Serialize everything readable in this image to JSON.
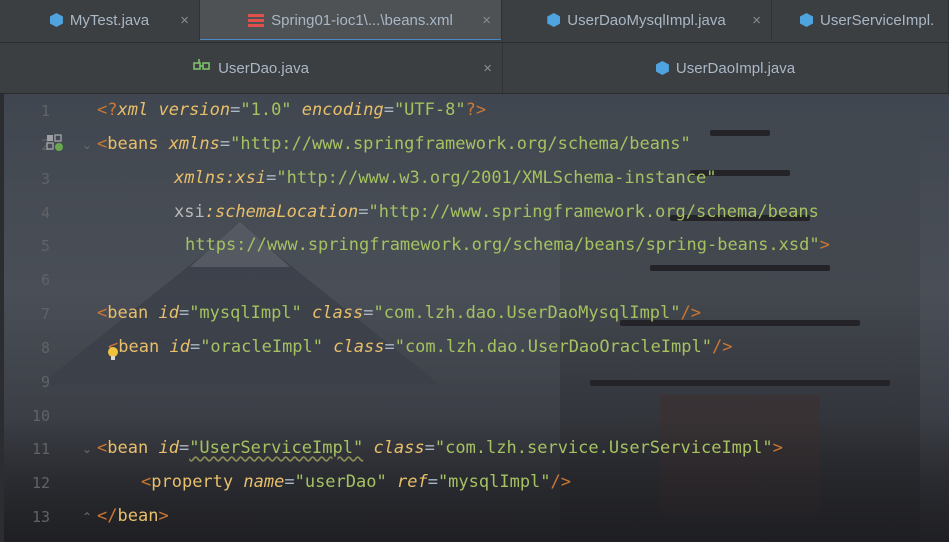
{
  "tabs_top": [
    {
      "label": "MyTest.java",
      "icon": "java-class-icon",
      "active": false
    },
    {
      "label": "Spring01-ioc1\\...\\beans.xml",
      "icon": "xml-file-icon",
      "active": true
    },
    {
      "label": "UserDaoMysqlImpl.java",
      "icon": "java-class-icon",
      "active": false
    },
    {
      "label": "UserServiceImpl.",
      "icon": "java-class-icon",
      "active": false
    }
  ],
  "tabs_second": [
    {
      "label": "UserDao.java",
      "icon": "interface-icon",
      "active": false
    },
    {
      "label": "UserDaoImpl.java",
      "icon": "java-class-icon",
      "active": false
    }
  ],
  "close_glyph": "×",
  "line_numbers": [
    "1",
    "2",
    "3",
    "4",
    "5",
    "6",
    "7",
    "8",
    "9",
    "10",
    "11",
    "12",
    "13"
  ],
  "code": {
    "l1": {
      "open": "<?",
      "pi": "xml",
      "a1": "version",
      "eq1": "=",
      "v1": "\"1.0\"",
      "a2": "encoding",
      "eq2": "=",
      "v2": "\"UTF-8\"",
      "close": "?>"
    },
    "l2": {
      "open": "<",
      "tag": "beans",
      "attr": "xmlns",
      "eq": "=",
      "val": "\"http://www.springframework.org/schema/beans\""
    },
    "l3": {
      "attr": "xmlns:",
      "attr2": "xsi",
      "eq": "=",
      "val": "\"http://www.w3.org/2001/XMLSchema-instance\""
    },
    "l4": {
      "attr": "xsi",
      "attr2": ":schemaLocation",
      "eq": "=",
      "val": "\"http://www.springframework.org/schema/beans"
    },
    "l5": {
      "val": "https://www.springframework.org/schema/beans/spring-beans.xsd\"",
      "close": ">"
    },
    "l7": {
      "open": "<",
      "tag": "bean",
      "a1": "id",
      "eq1": "=",
      "v1": "\"mysqlImpl\"",
      "a2": "class",
      "eq2": "=",
      "v2": "\"com.lzh.dao.UserDaoMysqlImpl\"",
      "close": "/>"
    },
    "l8": {
      "open": "<",
      "tag": "bean",
      "a1": "id",
      "eq1": "=",
      "v1": "\"oracleImpl\"",
      "a2": "class",
      "eq2": "=",
      "v2": "\"com.lzh.dao.UserDaoOracleImpl\"",
      "close": "/>"
    },
    "l11": {
      "open": "<",
      "tag": "bean",
      "a1": "id",
      "eq1": "=",
      "v1": "\"UserServiceImpl\"",
      "a2": "class",
      "eq2": "=",
      "v2": "\"com.lzh.service.UserServiceImpl\"",
      "close": ">"
    },
    "l12": {
      "open": "<",
      "tag": "property",
      "a1": "name",
      "eq1": "=",
      "v1": "\"userDao\"",
      "a2": "ref",
      "eq2": "=",
      "v2": "\"mysqlImpl\"",
      "close": "/>"
    },
    "l13": {
      "open": "</",
      "tag": "bean",
      "close": ">"
    }
  },
  "colors": {
    "tab_bg": "#3c3f41",
    "active_underline": "#4a88c7",
    "tag": "#e8bf6a",
    "string": "#6a8759",
    "bracket": "#cc7832"
  }
}
